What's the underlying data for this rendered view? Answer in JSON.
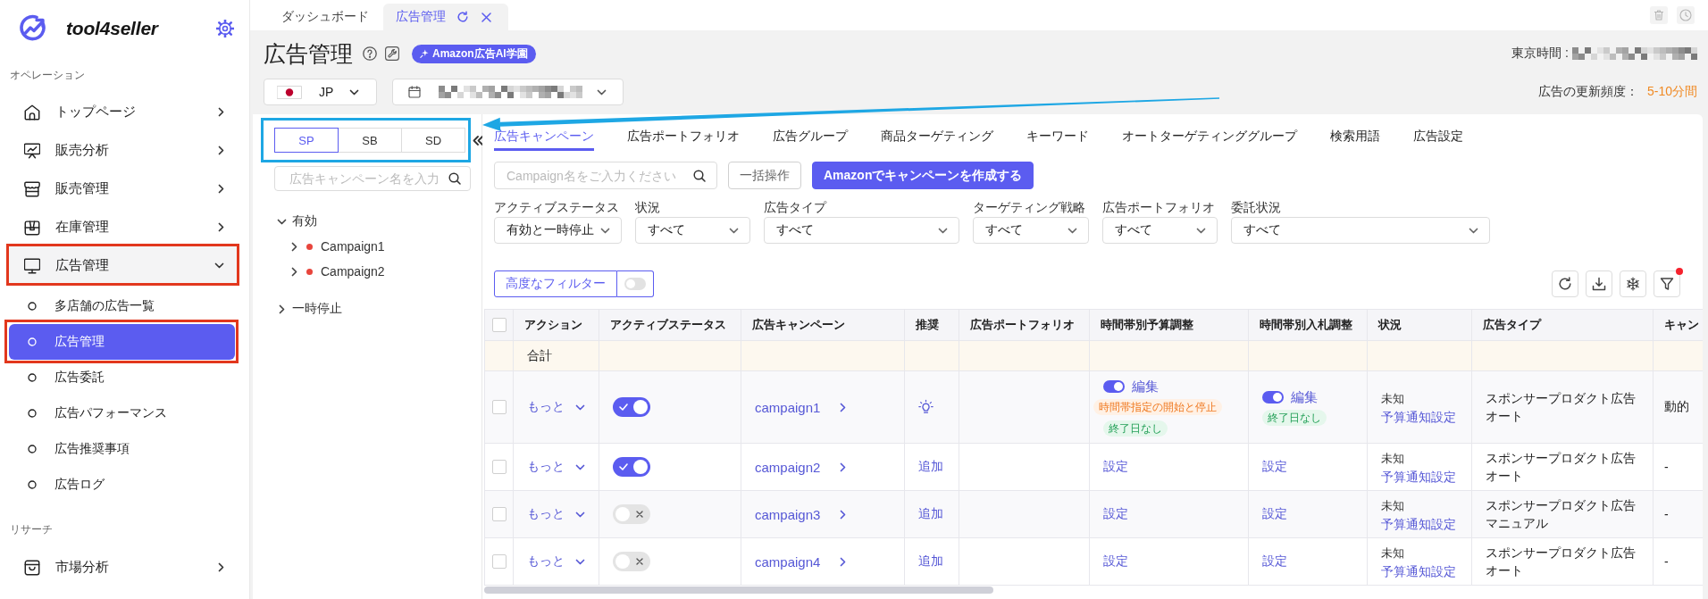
{
  "sidebar": {
    "logo": "tool4seller",
    "sections": [
      {
        "label": "オペレーション",
        "items": [
          {
            "label": "トップページ",
            "expanded": false,
            "annotated": false
          },
          {
            "label": "販売分析",
            "expanded": false,
            "annotated": false
          },
          {
            "label": "販売管理",
            "expanded": false,
            "annotated": false
          },
          {
            "label": "在庫管理",
            "expanded": false,
            "annotated": false
          },
          {
            "label": "広告管理",
            "expanded": true,
            "annotated": true,
            "children": [
              {
                "label": "多店舗の広告一覧",
                "selected": false,
                "annotated": false
              },
              {
                "label": "広告管理",
                "selected": true,
                "annotated": true
              },
              {
                "label": "広告委託",
                "selected": false,
                "annotated": false
              },
              {
                "label": "広告パフォーマンス",
                "selected": false,
                "annotated": false
              },
              {
                "label": "広告推奨事項",
                "selected": false,
                "annotated": false
              },
              {
                "label": "広告ログ",
                "selected": false,
                "annotated": false
              }
            ]
          }
        ]
      },
      {
        "label": "リサーチ",
        "items": [
          {
            "label": "市場分析",
            "expanded": false,
            "annotated": false
          }
        ]
      }
    ]
  },
  "page_tabs": [
    {
      "label": "ダッシュボード",
      "selected": false,
      "closable": false
    },
    {
      "label": "広告管理",
      "selected": true,
      "closable": true
    }
  ],
  "header": {
    "title": "広告管理",
    "badge": "Amazon広告AI学園",
    "clock": {
      "label": "東京時間 :",
      "redacted": true
    },
    "update": {
      "label": "広告の更新頻度：",
      "value": "5-10分間"
    }
  },
  "marketplace": {
    "value": "JP"
  },
  "date_range": {
    "redacted": true
  },
  "ad_panel": {
    "annotated": true,
    "ad_types": [
      {
        "label": "SP",
        "selected": true
      },
      {
        "label": "SB",
        "selected": false
      },
      {
        "label": "SD",
        "selected": false
      }
    ],
    "search": {
      "placeholder": "広告キャンペーン名を入力"
    },
    "tree": [
      {
        "label": "有効",
        "expanded": true,
        "children": [
          {
            "label": "Campaign1",
            "expanded": false,
            "color": "#e8453c"
          },
          {
            "label": "Campaign2",
            "expanded": false,
            "color": "#e8453c"
          }
        ]
      },
      {
        "label": "一時停止",
        "expanded": false
      }
    ]
  },
  "content_tabs": [
    {
      "label": "広告キャンペーン",
      "selected": true
    },
    {
      "label": "広告ポートフォリオ",
      "selected": false
    },
    {
      "label": "広告グループ",
      "selected": false
    },
    {
      "label": "商品ターゲティング",
      "selected": false
    },
    {
      "label": "キーワード",
      "selected": false
    },
    {
      "label": "オートターゲティンググループ",
      "selected": false
    },
    {
      "label": "検索用語",
      "selected": false
    },
    {
      "label": "広告設定",
      "selected": false
    }
  ],
  "toolbar": {
    "search": {
      "placeholder": "Campaign名をご入力ください"
    },
    "buttons": [
      {
        "label": "一括操作",
        "kind": "outline"
      },
      {
        "label": "Amazonでキャンペーンを作成する",
        "kind": "primary"
      }
    ]
  },
  "filters": [
    {
      "label": "アクティブステータス",
      "value": "有効と一時停止"
    },
    {
      "label": "状況",
      "value": "すべて"
    },
    {
      "label": "広告タイプ",
      "value": "すべて"
    },
    {
      "label": "ターゲティング戦略",
      "value": "すべて"
    },
    {
      "label": "広告ポートフォリオ",
      "value": "すべて"
    },
    {
      "label": "委託状況",
      "value": "すべて"
    }
  ],
  "advanced_filter": {
    "label": "高度なフィルター",
    "on": false
  },
  "table_tools": {
    "filter_dot": true
  },
  "table": {
    "header_checked": false,
    "columns": [
      "アクション",
      "アクティブステータス",
      "広告キャンペーン",
      "推奨",
      "広告ポートフォリオ",
      "時間帯別予算調整",
      "時間帯別入札調整",
      "状況",
      "広告タイプ",
      "キャン"
    ],
    "total_label": "合計",
    "rows": [
      {
        "checked": false,
        "action": "もっと",
        "active": true,
        "campaign": "campaign1",
        "recommendation": {
          "kind": "icon"
        },
        "budget_schedule": {
          "kind": "schedule",
          "on": true,
          "label": "編集",
          "tags": [
            {
              "label": "時間帯指定の開始と停止",
              "kind": "warning"
            },
            {
              "label": "終了日なし",
              "kind": "success"
            }
          ]
        },
        "bid_schedule": {
          "kind": "schedule",
          "on": true,
          "label": "編集",
          "tags": [
            {
              "label": "終了日なし",
              "kind": "success"
            }
          ]
        },
        "status": "未知",
        "status_link": "予算通知設定",
        "ad_type": "スポンサープロダクト広告",
        "targeting": "オート",
        "column_11": "動的"
      },
      {
        "checked": false,
        "action": "もっと",
        "active": true,
        "campaign": "campaign2",
        "recommendation": {
          "kind": "link",
          "label": "追加"
        },
        "budget_schedule": {
          "kind": "link",
          "label": "設定"
        },
        "bid_schedule": {
          "kind": "link",
          "label": "設定"
        },
        "status": "未知",
        "status_link": "予算通知設定",
        "ad_type": "スポンサープロダクト広告",
        "targeting": "オート",
        "column_11": "-"
      },
      {
        "checked": false,
        "action": "もっと",
        "active": false,
        "campaign": "campaign3",
        "recommendation": {
          "kind": "link",
          "label": "追加"
        },
        "budget_schedule": {
          "kind": "link",
          "label": "設定"
        },
        "bid_schedule": {
          "kind": "link",
          "label": "設定"
        },
        "status": "未知",
        "status_link": "予算通知設定",
        "ad_type": "スポンサープロダクト広告",
        "targeting": "マニュアル",
        "column_11": "-"
      },
      {
        "checked": false,
        "action": "もっと",
        "active": false,
        "campaign": "campaign4",
        "recommendation": {
          "kind": "link",
          "label": "追加"
        },
        "budget_schedule": {
          "kind": "link",
          "label": "設定"
        },
        "bid_schedule": {
          "kind": "link",
          "label": "設定"
        },
        "status": "未知",
        "status_link": "予算通知設定",
        "ad_type": "スポンサープロダクト広告",
        "targeting": "オート",
        "column_11": "-"
      }
    ]
  }
}
